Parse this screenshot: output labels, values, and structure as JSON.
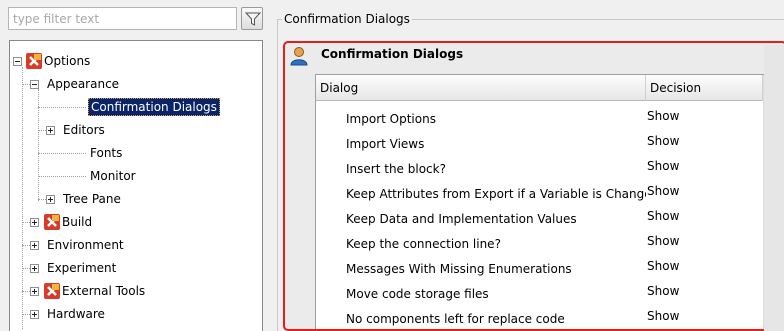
{
  "filter": {
    "placeholder": "type filter text"
  },
  "tree": {
    "root_label": "Options",
    "appearance_label": "Appearance",
    "appearance_children": [
      "Confirmation Dialogs",
      "Editors",
      "Fonts",
      "Monitor",
      "Tree Pane"
    ],
    "top_level": [
      "Build",
      "Environment",
      "Experiment",
      "External Tools",
      "Hardware"
    ]
  },
  "section": {
    "caption": "Confirmation Dialogs",
    "panel_title": "Confirmation Dialogs"
  },
  "grid": {
    "columns": [
      "Dialog",
      "Decision"
    ],
    "rows": [
      {
        "dialog": "Import Options",
        "decision": "Show"
      },
      {
        "dialog": "Import Views",
        "decision": "Show"
      },
      {
        "dialog": "Insert the block?",
        "decision": "Show"
      },
      {
        "dialog": "Keep Attributes from Export if a Variable is Changed",
        "decision": "Show"
      },
      {
        "dialog": "Keep Data and Implementation Values",
        "decision": "Show"
      },
      {
        "dialog": "Keep the connection line?",
        "decision": "Show"
      },
      {
        "dialog": "Messages With Missing Enumerations",
        "decision": "Show"
      },
      {
        "dialog": "Move code storage files",
        "decision": "Show"
      },
      {
        "dialog": "No components left for replace code",
        "decision": "Show"
      }
    ]
  },
  "colors": {
    "selection": "#0a246a",
    "panel_border": "#e51d1d"
  }
}
